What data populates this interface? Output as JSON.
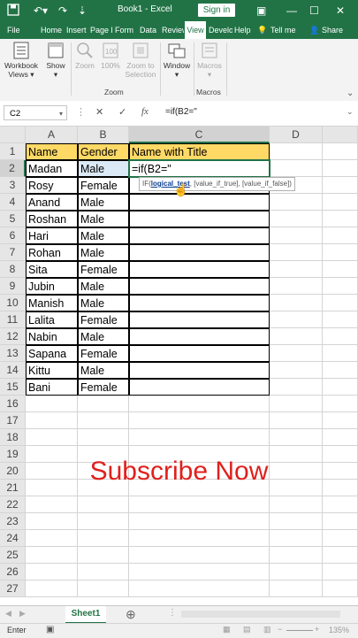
{
  "titlebar": {
    "title": "Book1  -  Excel",
    "signin": "Sign in"
  },
  "ribbon_tabs": [
    "File",
    "Home",
    "Insert",
    "Page l",
    "Form",
    "Data",
    "Review",
    "View",
    "Develo",
    "Help",
    "Tell me",
    "Share"
  ],
  "ribbon": {
    "workbook_views": "Workbook Views",
    "show": "Show",
    "zoom": "Zoom",
    "zoom100": "100%",
    "zoom_to_selection": "Zoom to Selection",
    "window": "Window",
    "macros": "Macros",
    "group_zoom": "Zoom",
    "group_macros": "Macros"
  },
  "formula_bar": {
    "name_box": "C2",
    "formula": "=if(B2=\""
  },
  "columns": [
    "A",
    "B",
    "C",
    "D"
  ],
  "rows": [
    "1",
    "2",
    "3",
    "4",
    "5",
    "6",
    "7",
    "8",
    "9",
    "10",
    "11",
    "12",
    "13",
    "14",
    "15",
    "16",
    "17",
    "18",
    "19",
    "20",
    "21",
    "22",
    "23",
    "24",
    "25",
    "26",
    "27"
  ],
  "headers": {
    "a": "Name",
    "b": "Gender",
    "c": "Name with Title"
  },
  "data": [
    [
      "Madan",
      "Male"
    ],
    [
      "Rosy",
      "Female"
    ],
    [
      "Anand",
      "Male"
    ],
    [
      "Roshan",
      "Male"
    ],
    [
      "Hari",
      "Male"
    ],
    [
      "Rohan",
      "Male"
    ],
    [
      "Sita",
      "Female"
    ],
    [
      "Jubin",
      "Male"
    ],
    [
      "Manish",
      "Male"
    ],
    [
      "Lalita",
      "Female"
    ],
    [
      "Nabin",
      "Male"
    ],
    [
      "Sapana",
      "Female"
    ],
    [
      "Kittu",
      "Male"
    ],
    [
      "Bani",
      "Female"
    ]
  ],
  "active_cell_text": "=if(B2=\"",
  "tooltip": {
    "fn": "IF(",
    "arg": "logical_test",
    "rest": ", [value_if_true], [value_if_false])"
  },
  "overlay_text": "Subscribe Now",
  "sheet_tab": "Sheet1",
  "status": {
    "mode": "Enter",
    "zoom": "135%"
  },
  "colors": {
    "excel_green": "#217346",
    "header_fill": "#ffd966",
    "overlay_red": "#e0201c"
  }
}
